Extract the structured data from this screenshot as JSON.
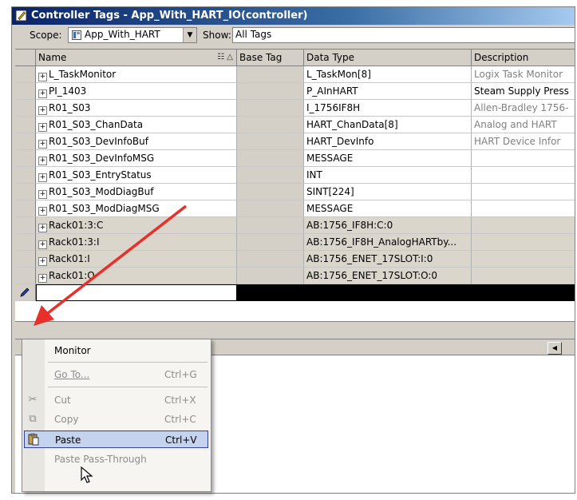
{
  "window": {
    "title": "Controller Tags - App_With_HART_IO(controller)"
  },
  "toolbar": {
    "scope_label": "Scope:",
    "scope_value": "App_With_HART",
    "show_label": "Show:",
    "show_value": "All Tags"
  },
  "table": {
    "headers": {
      "name": "Name",
      "base_tag": "Base Tag",
      "data_type": "Data Type",
      "description": "Description"
    },
    "rows": [
      {
        "name": "L_TaskMonitor",
        "data_type": "L_TaskMon[8]",
        "description": "Logix Task Monitor"
      },
      {
        "name": "PI_1403",
        "data_type": "P_AInHART",
        "description": "Steam Supply Press"
      },
      {
        "name": "R01_S03",
        "data_type": "I_1756IF8H",
        "description": "Allen-Bradley 1756-"
      },
      {
        "name": "R01_S03_ChanData",
        "data_type": "HART_ChanData[8]",
        "description": "Analog and HART"
      },
      {
        "name": "R01_S03_DevInfoBuf",
        "data_type": "HART_DevInfo",
        "description": "HART Device Infor"
      },
      {
        "name": "R01_S03_DevInfoMSG",
        "data_type": "MESSAGE",
        "description": ""
      },
      {
        "name": "R01_S03_EntryStatus",
        "data_type": "INT",
        "description": ""
      },
      {
        "name": "R01_S03_ModDiagBuf",
        "data_type": "SINT[224]",
        "description": ""
      },
      {
        "name": "R01_S03_ModDiagMSG",
        "data_type": "MESSAGE",
        "description": ""
      },
      {
        "name": "Rack01:3:C",
        "data_type": "AB:1756_IF8H:C:0",
        "description": ""
      },
      {
        "name": "Rack01:3:I",
        "data_type": "AB:1756_IF8H_AnalogHARTby...",
        "description": ""
      },
      {
        "name": "Rack01:I",
        "data_type": "AB:1756_ENET_17SLOT:I:0",
        "description": ""
      },
      {
        "name": "Rack01:O",
        "data_type": "AB:1756_ENET_17SLOT:O:0",
        "description": ""
      }
    ]
  },
  "context_menu": {
    "items": [
      {
        "label": "Monitor",
        "shortcut": "",
        "icon": "",
        "enabled": true
      },
      {
        "label": "Go To...",
        "shortcut": "Ctrl+G",
        "icon": "",
        "enabled": false
      },
      {
        "label": "Cut",
        "shortcut": "Ctrl+X",
        "icon": "scissors-icon",
        "enabled": false
      },
      {
        "label": "Copy",
        "shortcut": "Ctrl+C",
        "icon": "copy-icon",
        "enabled": false
      },
      {
        "label": "Paste",
        "shortcut": "Ctrl+V",
        "icon": "paste-icon",
        "enabled": true,
        "highlighted": true
      },
      {
        "label": "Paste Pass-Through",
        "shortcut": "",
        "icon": "",
        "enabled": false
      }
    ]
  },
  "colors": {
    "title_start": "#0a246a",
    "title_end": "#a6caf0",
    "menu_highlight": "#c5d3ee",
    "arrow": "#e8302a"
  }
}
